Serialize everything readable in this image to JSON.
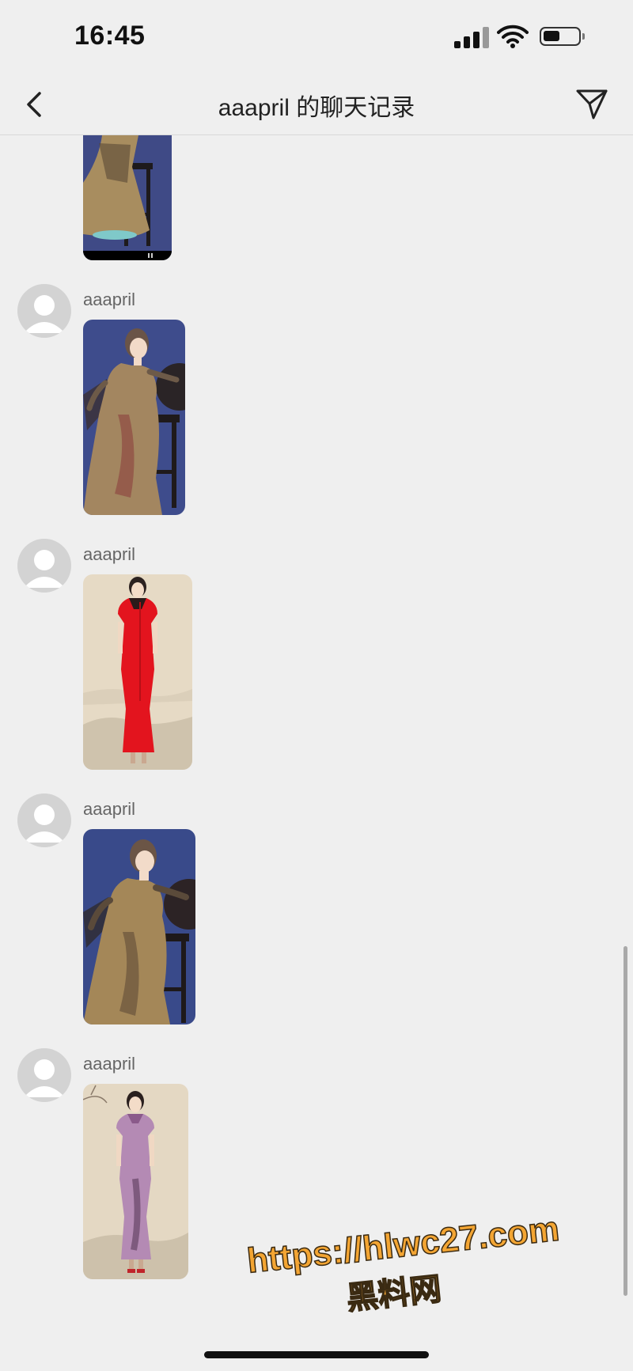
{
  "status_bar": {
    "time": "16:45",
    "signal_icon": "cellular-signal-icon",
    "wifi_icon": "wifi-icon",
    "battery_icon": "battery-icon",
    "battery_level": 0.45
  },
  "nav": {
    "back_icon": "chevron-left-icon",
    "title": "aaapril 的聊天记录",
    "send_icon": "paper-plane-icon"
  },
  "messages": [
    {
      "sender": "",
      "image": "video-thumbnail-seated-figure"
    },
    {
      "sender": "aaapril",
      "image": "illustration-woman-seated-blue-background"
    },
    {
      "sender": "aaapril",
      "image": "illustration-woman-red-qipao"
    },
    {
      "sender": "aaapril",
      "image": "illustration-woman-seated-blue-background"
    },
    {
      "sender": "aaapril",
      "image": "illustration-woman-purple-qipao"
    }
  ],
  "watermark": {
    "url": "https://hlwc27.com",
    "cn": "黑料网"
  },
  "colors": {
    "background": "#efefef",
    "watermark": "#f3a533"
  }
}
